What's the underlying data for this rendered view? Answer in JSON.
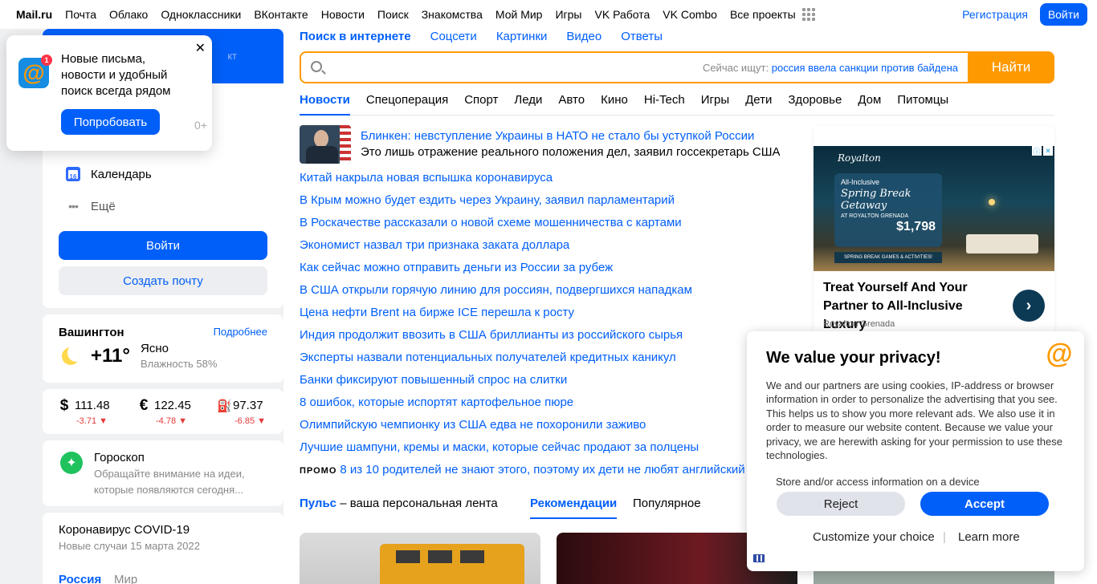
{
  "topnav": {
    "brand": "Mail.ru",
    "items": [
      "Почта",
      "Облако",
      "Одноклассники",
      "ВКонтакте",
      "Новости",
      "Поиск",
      "Знакомства",
      "Мой Мир",
      "Игры",
      "VK Работа",
      "VK Combo",
      "Все проекты"
    ],
    "register": "Регистрация",
    "login": "Войти"
  },
  "popup": {
    "badge": "1",
    "text": "Новые письма, новости и удобный поиск всегда рядом",
    "button": "Попробовать",
    "age": "0+"
  },
  "mail_card": {
    "vk_tail": "кт",
    "calendar_day": "16",
    "calendar": "Календарь",
    "more": "Ещё",
    "login_button": "Войти",
    "create_button": "Создать почту"
  },
  "weather": {
    "city": "Вашингтон",
    "more": "Подробнее",
    "temp": "+11°",
    "condition": "Ясно",
    "humidity": "Влажность 58%"
  },
  "rates": [
    {
      "symbol": "$",
      "value": "111.48",
      "change": "-3.71 ▼"
    },
    {
      "symbol": "€",
      "value": "122.45",
      "change": "-4.78 ▼"
    },
    {
      "symbol": "⛽",
      "value": "97.37",
      "change": "-6.85 ▼"
    }
  ],
  "horoscope": {
    "title": "Гороскоп",
    "desc": "Обращайте внимание на идеи, которые появляются сегодня..."
  },
  "covid": {
    "title": "Коронавирус COVID-19",
    "sub": "Новые случаи 15 марта 2022",
    "tab_a": "Россия",
    "tab_b": "Мир"
  },
  "search": {
    "tabs": [
      "Поиск в интернете",
      "Соцсети",
      "Картинки",
      "Видео",
      "Ответы"
    ],
    "hint_label": "Сейчас ищут:",
    "hint_query": "россия ввела санкции против байдена",
    "button": "Найти"
  },
  "news_tabs": [
    "Новости",
    "Спецоперация",
    "Спорт",
    "Леди",
    "Авто",
    "Кино",
    "Hi-Tech",
    "Игры",
    "Дети",
    "Здоровье",
    "Дом",
    "Питомцы"
  ],
  "lead": {
    "title": "Блинкен: невступление Украины в НАТО не стало бы уступкой России",
    "sub": "Это лишь отражение реального положения дел, заявил госсекретарь США"
  },
  "news": [
    "Китай накрыла новая вспышка коронавируса",
    "В Крым можно будет ездить через Украину, заявил парламентарий",
    "В Роскачестве рассказали о новой схеме мошенничества с картами",
    "Экономист назвал три признака заката доллара",
    "Как сейчас можно отправить деньги из России за рубеж",
    "В США открыли горячую линию для россиян, подвергшихся нападкам",
    "Цена нефти Brent на бирже ICE перешла к росту",
    "Индия продолжит ввозить в США бриллианты из российского сырья",
    "Эксперты назвали потенциальных получателей кредитных каникул",
    "Банки фиксируют повышенный спрос на слитки",
    "8 ошибок, которые испортят картофельное пюре",
    "Олимпийскую чемпионку из США едва не похоронили заживо",
    "Лучшие шампуни, кремы и маски, которые сейчас продают за полцены"
  ],
  "promo": {
    "label": "ПРОМО",
    "text": "8 из 10 родителей не знают этого, поэтому их дети не любят английский"
  },
  "pulse": {
    "name": "Пульс",
    "tagline": " – ваша персональная лента",
    "rec": "Рекомендации",
    "popular": "Популярное"
  },
  "ad": {
    "brand": "Royalton",
    "panel_small": "All-Inclusive",
    "panel_big": "Spring Break Getaway",
    "panel_loc": "AT ROYALTON GRENADA",
    "price": "$1,798",
    "strip": "SPRING BREAK GAMES & ACTIVITIES!",
    "title": "Treat Yourself And Your Partner to All-Inclusive Luxury",
    "source": "Royalton Grenada"
  },
  "cookie": {
    "title": "We value your privacy!",
    "body": "We and our partners are using cookies, IP-address or browser information in order to personalize the advertising that you see. This helps us to show you more relevant ads. We also use it in order to measure our website content. Because we value your privacy, we are herewith asking for your permission to use these technologies.",
    "store": "Store and/or access information on a device",
    "reject": "Reject",
    "accept": "Accept",
    "customize": "Customize your choice",
    "separator": "|",
    "learn": "Learn more"
  }
}
